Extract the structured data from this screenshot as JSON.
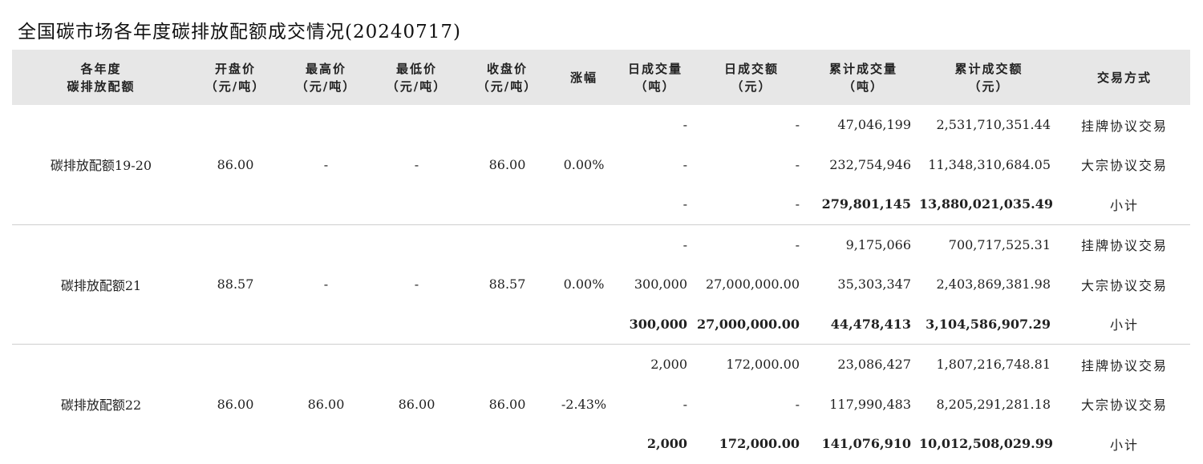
{
  "title": "全国碳市场各年度碳排放配额成交情况(20240717)",
  "headers": [
    {
      "l1": "各年度",
      "l2": "碳排放配额"
    },
    {
      "l1": "开盘价",
      "l2": "（元/吨）"
    },
    {
      "l1": "最高价",
      "l2": "（元/吨）"
    },
    {
      "l1": "最低价",
      "l2": "（元/吨）"
    },
    {
      "l1": "收盘价",
      "l2": "（元/吨）"
    },
    {
      "l1": "涨幅",
      "l2": ""
    },
    {
      "l1": "日成交量",
      "l2": "（吨）"
    },
    {
      "l1": "日成交额",
      "l2": "（元）"
    },
    {
      "l1": "累计成交量",
      "l2": "（吨）"
    },
    {
      "l1": "累计成交额",
      "l2": "（元）"
    },
    {
      "l1": "交易方式",
      "l2": ""
    }
  ],
  "groups": [
    {
      "name": "碳排放配额19-20",
      "open": "86.00",
      "high": "-",
      "low": "-",
      "close": "86.00",
      "change": "0.00%",
      "rows": [
        {
          "day_vol": "-",
          "day_amt": "-",
          "cum_vol": "47,046,199",
          "cum_amt": "2,531,710,351.44",
          "mode": "挂牌协议交易"
        },
        {
          "day_vol": "-",
          "day_amt": "-",
          "cum_vol": "232,754,946",
          "cum_amt": "11,348,310,684.05",
          "mode": "大宗协议交易"
        },
        {
          "day_vol": "-",
          "day_amt": "-",
          "cum_vol": "279,801,145",
          "cum_amt": "13,880,021,035.49",
          "mode": "小计"
        }
      ]
    },
    {
      "name": "碳排放配额21",
      "open": "88.57",
      "high": "-",
      "low": "-",
      "close": "88.57",
      "change": "0.00%",
      "rows": [
        {
          "day_vol": "-",
          "day_amt": "-",
          "cum_vol": "9,175,066",
          "cum_amt": "700,717,525.31",
          "mode": "挂牌协议交易"
        },
        {
          "day_vol": "300,000",
          "day_amt": "27,000,000.00",
          "cum_vol": "35,303,347",
          "cum_amt": "2,403,869,381.98",
          "mode": "大宗协议交易"
        },
        {
          "day_vol": "300,000",
          "day_amt": "27,000,000.00",
          "cum_vol": "44,478,413",
          "cum_amt": "3,104,586,907.29",
          "mode": "小计"
        }
      ]
    },
    {
      "name": "碳排放配额22",
      "open": "86.00",
      "high": "86.00",
      "low": "86.00",
      "close": "86.00",
      "change": "-2.43%",
      "rows": [
        {
          "day_vol": "2,000",
          "day_amt": "172,000.00",
          "cum_vol": "23,086,427",
          "cum_amt": "1,807,216,748.81",
          "mode": "挂牌协议交易"
        },
        {
          "day_vol": "-",
          "day_amt": "-",
          "cum_vol": "117,990,483",
          "cum_amt": "8,205,291,281.18",
          "mode": "大宗协议交易"
        },
        {
          "day_vol": "2,000",
          "day_amt": "172,000.00",
          "cum_vol": "141,076,910",
          "cum_amt": "10,012,508,029.99",
          "mode": "小计"
        }
      ]
    }
  ]
}
